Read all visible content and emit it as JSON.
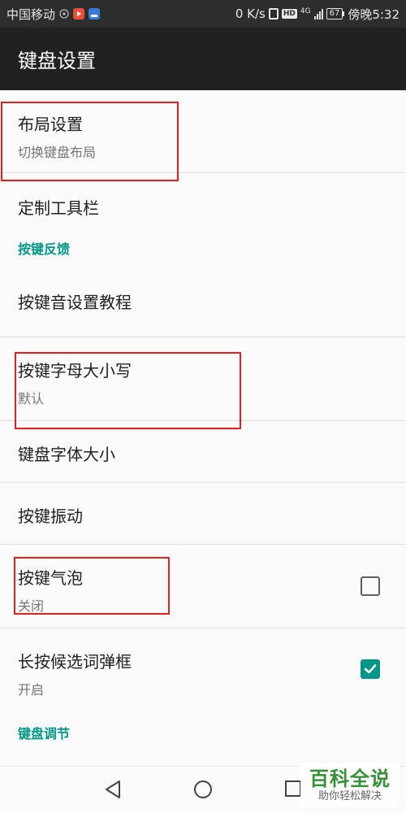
{
  "status_bar": {
    "carrier": "中国移动",
    "speed": "0 K/s",
    "network": "4G",
    "hd": "HD",
    "battery": "67",
    "time": "傍晚5:32"
  },
  "app_bar": {
    "title": "键盘设置"
  },
  "items": {
    "layout": {
      "title": "布局设置",
      "summary": "切换键盘布局"
    },
    "toolbar": {
      "title": "定制工具栏"
    },
    "key_sound_tutorial": {
      "title": "按键音设置教程"
    },
    "key_case": {
      "title": "按键字母大小写",
      "summary": "默认"
    },
    "font_size": {
      "title": "键盘字体大小"
    },
    "vibration": {
      "title": "按键振动"
    },
    "bubble": {
      "title": "按键气泡",
      "summary": "关闭",
      "checked": false
    },
    "long_press": {
      "title": "长按候选词弹框",
      "summary": "开启",
      "checked": true
    }
  },
  "sections": {
    "feedback": "按键反馈",
    "adjust": "键盘调节"
  },
  "watermark": {
    "title": "百科全说",
    "subtitle": "助你轻松解决"
  },
  "colors": {
    "accent": "#009688",
    "app_bar": "#212121",
    "highlight": "#e02020"
  }
}
